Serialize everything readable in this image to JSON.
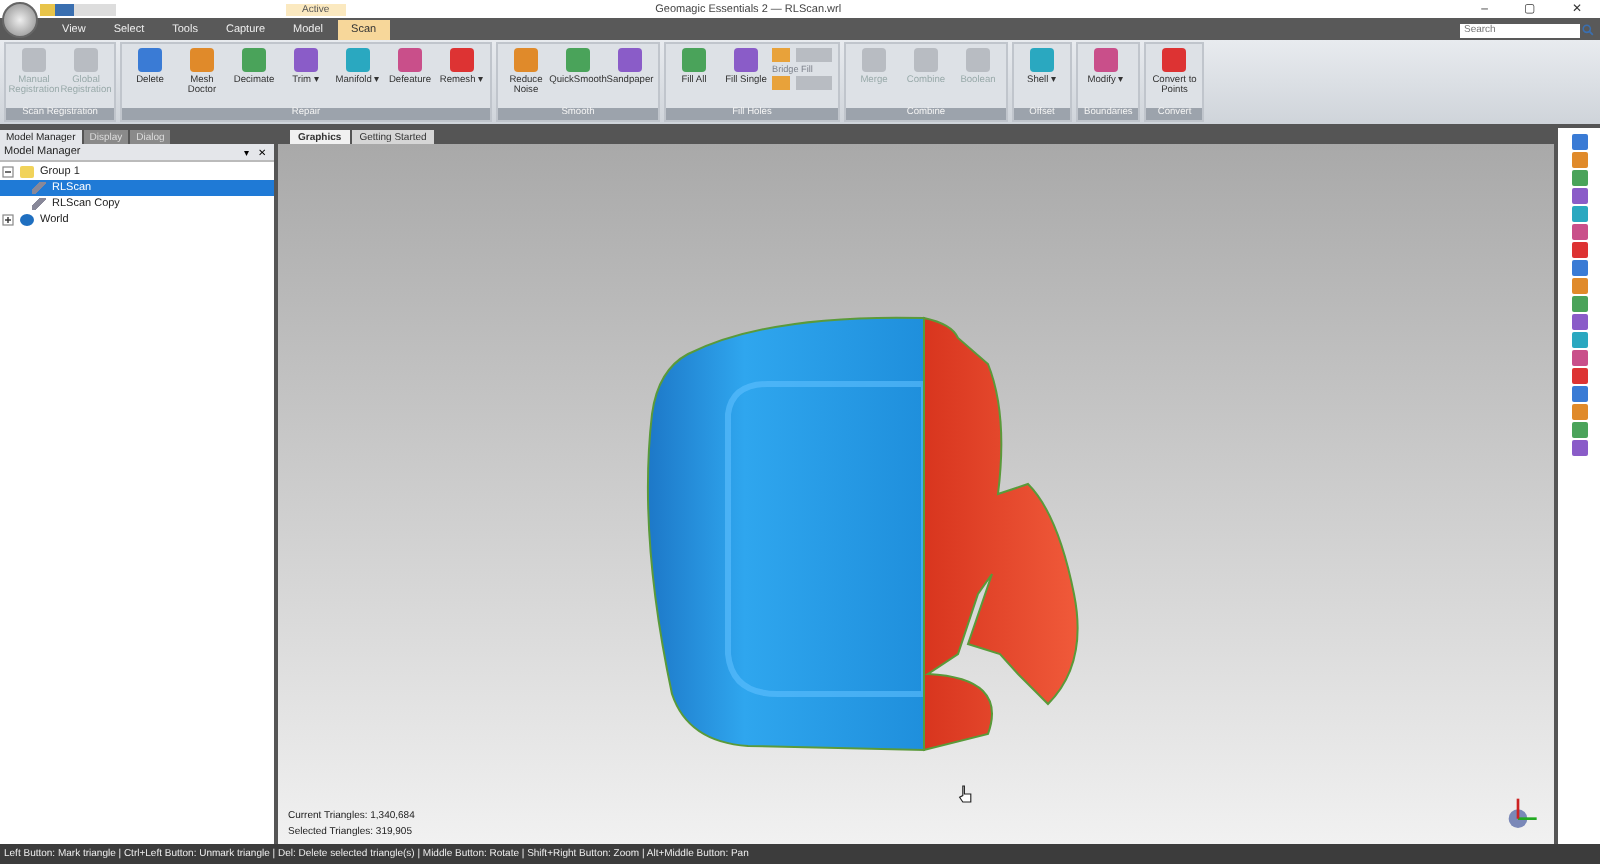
{
  "window": {
    "context_label": "Active",
    "title": "Geomagic Essentials 2 — RLScan.wrl",
    "controls": [
      "–",
      "▢",
      "✕"
    ]
  },
  "menu_tabs": [
    {
      "label": "View",
      "selected": false
    },
    {
      "label": "Select",
      "selected": false
    },
    {
      "label": "Tools",
      "selected": false
    },
    {
      "label": "Capture",
      "selected": false
    },
    {
      "label": "Model",
      "selected": false
    },
    {
      "label": "Scan",
      "selected": true
    }
  ],
  "search": {
    "placeholder": "Search"
  },
  "ribbon_groups": [
    {
      "title": "Scan Registration",
      "tools": [
        {
          "label": "Manual Registration",
          "disabled": true
        },
        {
          "label": "Global Registration",
          "disabled": true
        }
      ]
    },
    {
      "title": "Repair",
      "tools": [
        {
          "label": "Delete",
          "disabled": false
        },
        {
          "label": "Mesh Doctor",
          "disabled": false
        },
        {
          "label": "Decimate",
          "disabled": false
        },
        {
          "label": "Trim ▾",
          "disabled": false
        },
        {
          "label": "Manifold ▾",
          "disabled": false
        },
        {
          "label": "Defeature",
          "disabled": false
        },
        {
          "label": "Remesh ▾",
          "disabled": false
        }
      ]
    },
    {
      "title": "Smooth",
      "tools": [
        {
          "label": "Reduce Noise",
          "disabled": false
        },
        {
          "label": "QuickSmooth",
          "disabled": false
        },
        {
          "label": "Sandpaper",
          "disabled": false
        }
      ]
    },
    {
      "title": "Fill Holes",
      "tools": [
        {
          "label": "Fill All",
          "disabled": false
        },
        {
          "label": "Fill Single",
          "disabled": false
        }
      ],
      "option": {
        "label": "Bridge Fill",
        "disabled": true
      }
    },
    {
      "title": "Combine",
      "tools": [
        {
          "label": "Merge",
          "disabled": true
        },
        {
          "label": "Combine",
          "disabled": true
        },
        {
          "label": "Boolean",
          "disabled": true
        }
      ]
    },
    {
      "title": "Offset",
      "tools": [
        {
          "label": "Shell ▾",
          "disabled": false
        }
      ]
    },
    {
      "title": "Boundaries",
      "tools": [
        {
          "label": "Modify ▾",
          "disabled": false
        }
      ]
    },
    {
      "title": "Convert",
      "tools": [
        {
          "label": "Convert to Points",
          "disabled": false
        }
      ]
    }
  ],
  "panel_tabs": [
    {
      "label": "Model Manager",
      "selected": true
    },
    {
      "label": "Display",
      "selected": false
    },
    {
      "label": "Dialog",
      "selected": false
    }
  ],
  "panel": {
    "title": "Model Manager",
    "buttons": [
      "▾",
      "✕"
    ]
  },
  "tree": [
    {
      "label": "Group 1",
      "expanded": true,
      "selected": false,
      "children": [
        {
          "label": "RLScan",
          "selected": true
        },
        {
          "label": "RLScan Copy",
          "selected": false
        }
      ]
    },
    {
      "label": "World",
      "expanded": false,
      "selected": false
    }
  ],
  "view_tabs": [
    {
      "label": "Graphics",
      "selected": true
    },
    {
      "label": "Getting Started",
      "selected": false
    }
  ],
  "stats": [
    "Current Triangles: 1,340,684",
    "Selected Triangles: 319,905"
  ],
  "status_bar": "Left Button: Mark triangle | Ctrl+Left Button: Unmark triangle | Del: Delete selected triangle(s) | Middle Button: Rotate | Shift+Right Button: Zoom | Alt+Middle Button: Pan"
}
